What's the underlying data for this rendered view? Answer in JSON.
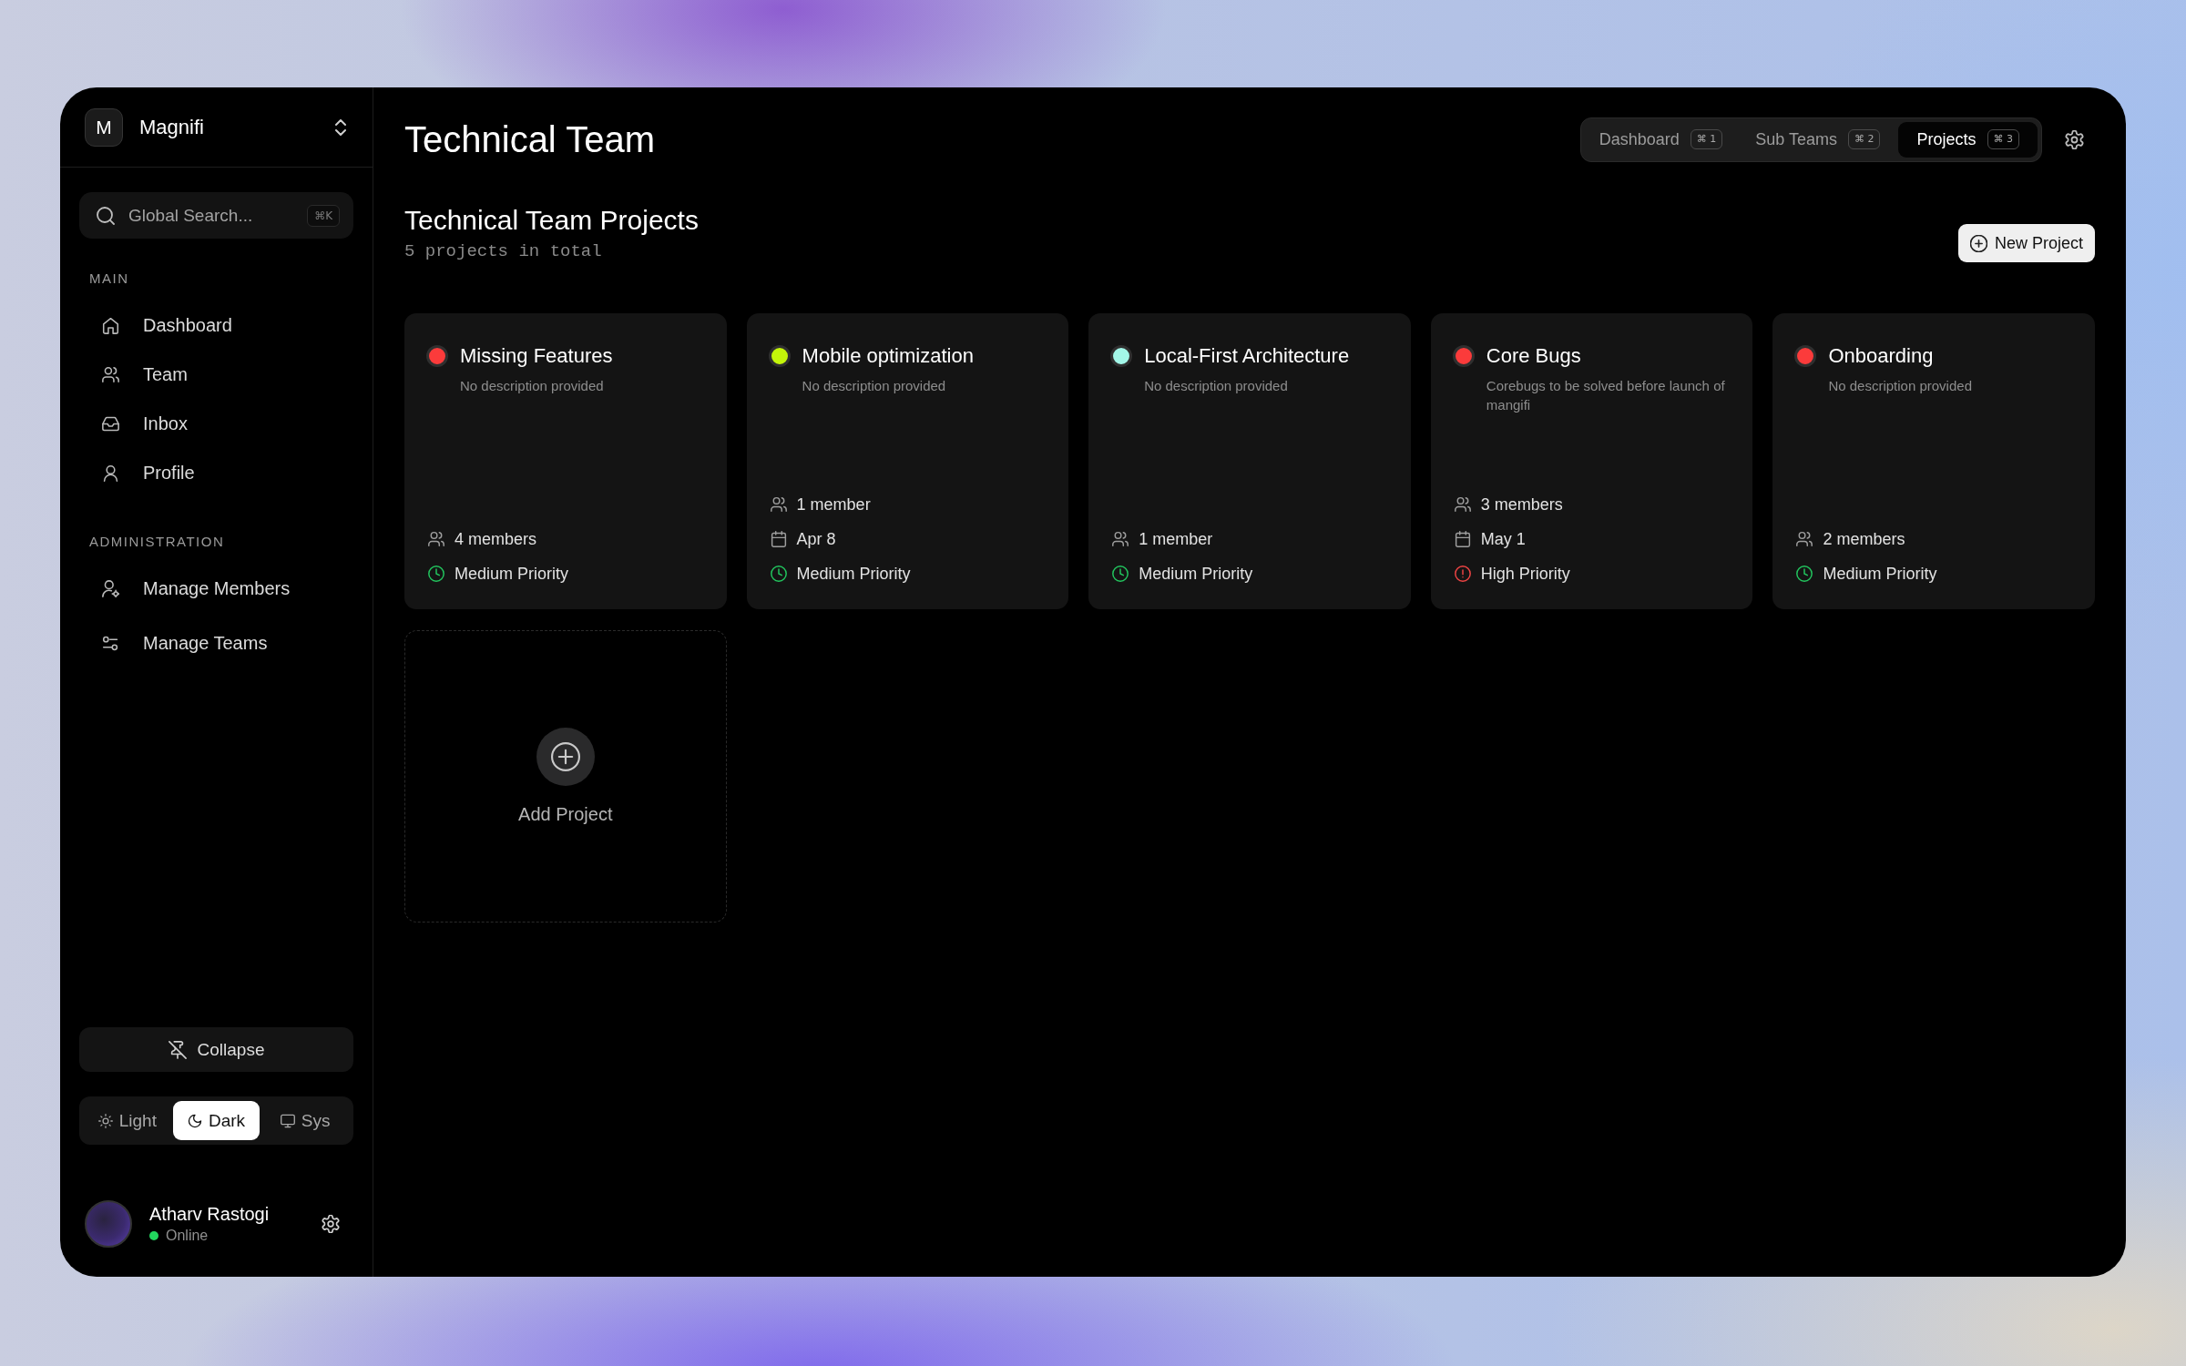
{
  "sidebar": {
    "workspace": {
      "initial": "M",
      "name": "Magnifi"
    },
    "search": {
      "placeholder": "Global Search...",
      "shortcut": "⌘K"
    },
    "sections": [
      {
        "title": "MAIN",
        "items": [
          {
            "label": "Dashboard"
          },
          {
            "label": "Team"
          },
          {
            "label": "Inbox"
          },
          {
            "label": "Profile"
          }
        ]
      },
      {
        "title": "ADMINISTRATION",
        "items": [
          {
            "label": "Manage Members"
          },
          {
            "label": "Manage Teams"
          }
        ]
      }
    ],
    "collapse_button": "Collapse",
    "theme_options": [
      {
        "label": "Light",
        "selected": false
      },
      {
        "label": "Dark",
        "selected": true
      },
      {
        "label": "Sys",
        "selected": false
      }
    ],
    "user": {
      "name": "Atharv Rastogi",
      "status": "Online",
      "online": true
    }
  },
  "header": {
    "title": "Technical Team",
    "tabs": [
      {
        "label": "Dashboard",
        "shortcut": "⌘ 1",
        "selected": false
      },
      {
        "label": "Sub Teams",
        "shortcut": "⌘ 2",
        "selected": false
      },
      {
        "label": "Projects",
        "shortcut": "⌘ 3",
        "selected": true
      }
    ]
  },
  "projects_section": {
    "title": "Technical Team Projects",
    "subtitle": "5 projects in total",
    "new_project_button": "New Project",
    "projects": [
      {
        "name": "Missing Features",
        "color": "#fb3b3b",
        "description": "No description provided",
        "members": "4 members",
        "priority": {
          "kind": "medium",
          "label": "Medium Priority"
        }
      },
      {
        "name": "Mobile optimization",
        "color": "#c4f50a",
        "description": "No description provided",
        "members": "1 member",
        "due": "Apr 8",
        "priority": {
          "kind": "medium",
          "label": "Medium Priority"
        }
      },
      {
        "name": "Local-First Architecture",
        "color": "#a3f7e8",
        "description": "No description provided",
        "members": "1 member",
        "priority": {
          "kind": "medium",
          "label": "Medium Priority"
        }
      },
      {
        "name": "Core Bugs",
        "color": "#fb3b3b",
        "description": "Corebugs to be solved before launch of mangifi",
        "members": "3 members",
        "due": "May 1",
        "priority": {
          "kind": "high",
          "label": "High Priority"
        }
      },
      {
        "name": "Onboarding",
        "color": "#fb3b3b",
        "description": "No description provided",
        "members": "2 members",
        "priority": {
          "kind": "medium",
          "label": "Medium Priority"
        }
      }
    ],
    "add_project_label": "Add Project"
  }
}
